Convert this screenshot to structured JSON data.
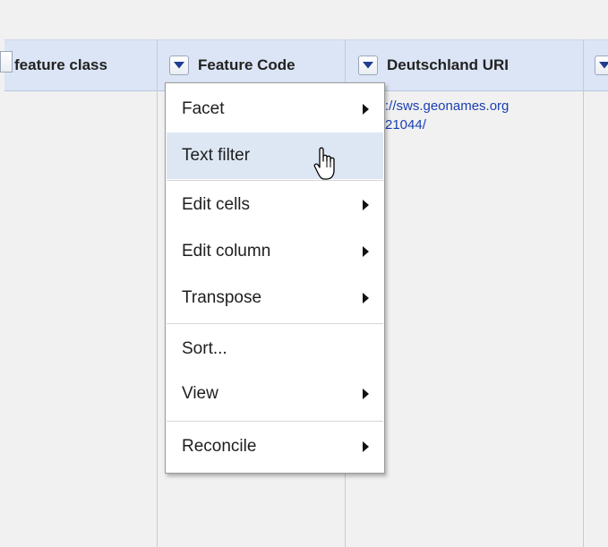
{
  "columns": [
    {
      "title": "feature class"
    },
    {
      "title": "Feature Code"
    },
    {
      "title": "Deutschland URI"
    }
  ],
  "cell": {
    "line1": "://sws.geonames.org",
    "line2": "21044/"
  },
  "menu": {
    "items": [
      {
        "label": "Facet",
        "submenu": true
      },
      {
        "label": "Text filter",
        "submenu": false,
        "hovered": true
      },
      {
        "label": "Edit cells",
        "submenu": true
      },
      {
        "label": "Edit column",
        "submenu": true
      },
      {
        "label": "Transpose",
        "submenu": true
      },
      {
        "label": "Sort...",
        "submenu": false
      },
      {
        "label": "View",
        "submenu": true
      },
      {
        "label": "Reconcile",
        "submenu": true
      }
    ]
  },
  "colors": {
    "header_bg": "#dbe5f5",
    "menu_hover": "#dde7f4",
    "link": "#1a3fb3",
    "dropdown_arrow": "#1f3d8f"
  },
  "icons": {
    "dropdown": "chevron-down-icon",
    "submenu": "chevron-right-icon",
    "cursor": "hand-pointer-cursor"
  }
}
